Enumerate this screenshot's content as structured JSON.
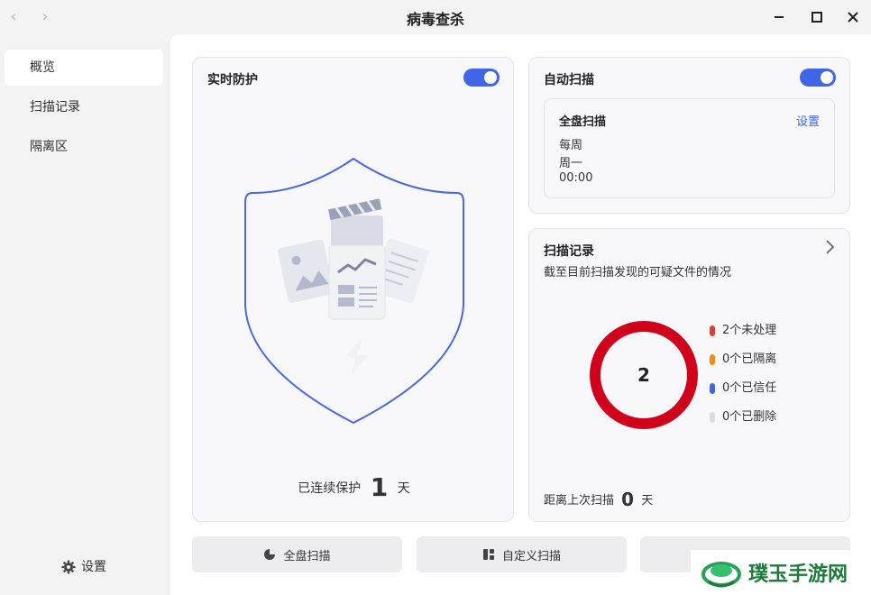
{
  "window": {
    "title": "病毒查杀",
    "nav_back_icon": "chevron-left-icon",
    "nav_forward_icon": "chevron-right-icon"
  },
  "sidebar": {
    "items": [
      {
        "label": "概览",
        "active": true
      },
      {
        "label": "扫描记录",
        "active": false
      },
      {
        "label": "隔离区",
        "active": false
      }
    ],
    "settings_label": "设置"
  },
  "protection": {
    "title": "实时防护",
    "enabled": true,
    "footer_prefix": "已连续保护",
    "days": "1",
    "footer_suffix": "天"
  },
  "auto_scan": {
    "title": "自动扫描",
    "enabled": true,
    "schedule": {
      "title": "全盘扫描",
      "settings_link": "设置",
      "frequency": "每周",
      "day": "周一",
      "time": "00:00"
    }
  },
  "records": {
    "title": "扫描记录",
    "subtitle": "截至目前扫描发现的可疑文件的情况",
    "total": "2",
    "legend": [
      {
        "label": "2个未处理",
        "color": "#e03b35"
      },
      {
        "label": "0个已隔离",
        "color": "#f08c1a"
      },
      {
        "label": "0个已信任",
        "color": "#3f66e8"
      },
      {
        "label": "0个已删除",
        "color": "#dcdcdc"
      }
    ],
    "ring_color": "#d0021b",
    "footer_prefix": "距离上次扫描",
    "days": "0",
    "footer_suffix": "天"
  },
  "actions": {
    "full_scan": "全盘扫描",
    "custom_scan": "自定义扫描"
  },
  "colors": {
    "accent": "#3f66e8",
    "shield_stroke": "#4a67e6"
  },
  "watermark": {
    "text": "璞玉手游网"
  }
}
